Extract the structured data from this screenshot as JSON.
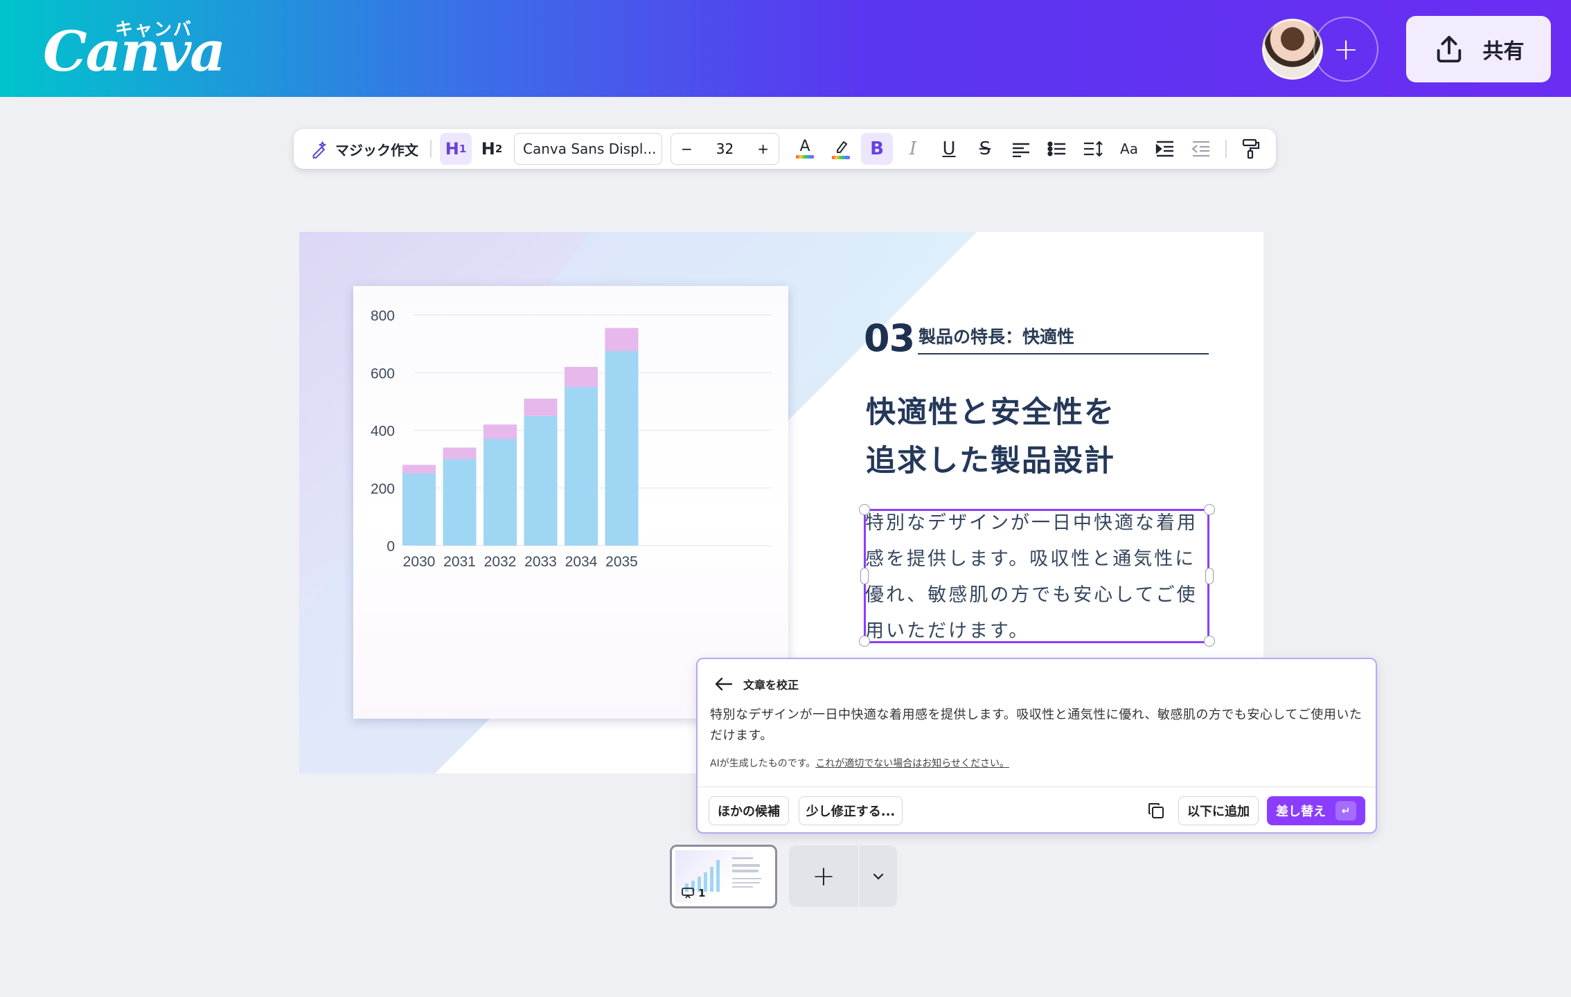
{
  "app": {
    "logo_kana": "キャンバ",
    "logo_word": "Canva"
  },
  "header": {
    "share_label": "共有",
    "add_collaborator_symbol": "+"
  },
  "toolbar": {
    "magic_write": "マジック作文",
    "h1": "H",
    "h1_sub": "1",
    "h2": "H",
    "h2_sub": "2",
    "font": "Canva Sans Displ...",
    "size": "32",
    "minus": "−",
    "plus": "+",
    "bold": "B",
    "italic": "I",
    "underline": "U",
    "strike": "S",
    "text_color_glyph": "A",
    "letter_spacing_glyph": "Aa"
  },
  "slide": {
    "number": "03",
    "section": "製品の特長：快適性",
    "title_line1": "快適性と安全性を",
    "title_line2": "追求した製品設計",
    "body": "特別なデザインが一日中快適な着用感を提供します。吸収性と通気性に優れ、敏感肌の方でも安心してご使用いただけます。"
  },
  "chart_data": {
    "type": "bar",
    "stacked": true,
    "categories": [
      "2030",
      "2031",
      "2032",
      "2033",
      "2034",
      "2035"
    ],
    "series": [
      {
        "values": [
          250,
          300,
          370,
          450,
          550,
          675
        ],
        "color": "#9fd6f4"
      },
      {
        "values": [
          30,
          40,
          50,
          60,
          70,
          80
        ],
        "color": "#e6b8ec"
      }
    ],
    "ylim": [
      0,
      800
    ],
    "yticks": [
      0,
      200,
      400,
      600,
      800
    ],
    "grid": true
  },
  "proofread": {
    "title": "文章を校正",
    "text": "特別なデザインが一日中快適な着用感を提供します。吸収性と通気性に優れ、敏感肌の方でも安心してご使用いただけます。",
    "note": "AIが生成したものです。",
    "note_link": "これが適切でない場合はお知らせください。",
    "btn_other": "ほかの候補",
    "btn_adjust": "少し修正する...",
    "btn_append": "以下に追加",
    "btn_replace": "差し替え",
    "enter_glyph": "↵"
  },
  "pages": {
    "current": "1"
  },
  "colors": {
    "accent": "#8b3dff",
    "heading": "#1e3250"
  }
}
